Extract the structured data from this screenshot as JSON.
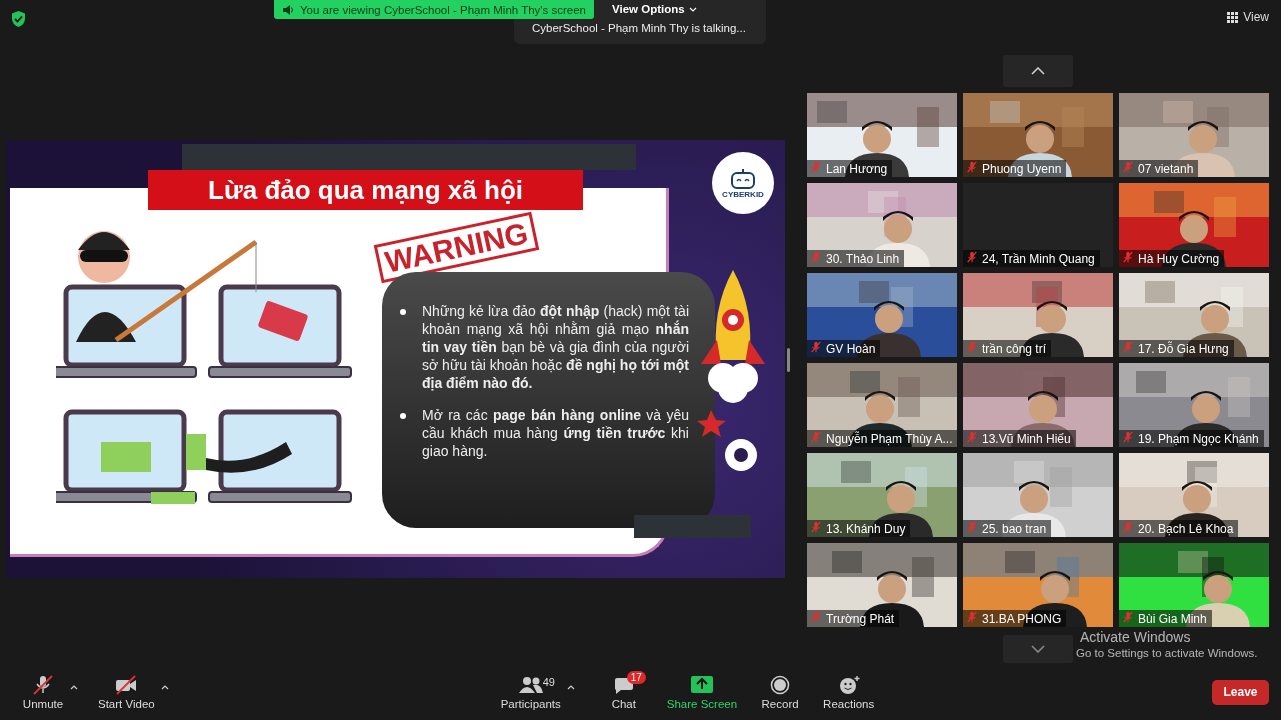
{
  "top_bar": {
    "banner": "You are viewing CyberSchool - Phạm Minh Thy's screen",
    "view_options": "View Options",
    "talking": "CyberSchool - Phạm Minh Thy is talking...",
    "view": "View"
  },
  "slide": {
    "title": "Lừa đảo qua mạng xã hội",
    "stamp": "WARNING",
    "logo": "CYBERKID",
    "bullets": [
      "Những kẻ lừa đảo **đột nhập** (hack) một tài khoản mạng xã hội nhằm giả mạo **nhắn tin vay tiền** bạn bè và gia đình của người sở hữu tài khoản hoặc **đề nghị họ tới một địa điểm nào đó.**",
      "Mở ra các **page bán hàng online** và yêu cầu khách mua hàng **ứng tiền trước** khi giao hàng."
    ]
  },
  "participants": [
    {
      "name": "Lan Hương",
      "muted": true,
      "kind": "picture"
    },
    {
      "name": "Phuong Uyenn",
      "muted": true,
      "kind": "picture"
    },
    {
      "name": "07 vietanh",
      "muted": true,
      "kind": "picture"
    },
    {
      "name": "30. Thảo Linh",
      "muted": true,
      "kind": "picture"
    },
    {
      "name": "24, Trần Minh Quang",
      "muted": true,
      "kind": "empty"
    },
    {
      "name": "Hà Huy Cường",
      "muted": true,
      "kind": "picture"
    },
    {
      "name": "GV Hoàn",
      "muted": true,
      "kind": "picture"
    },
    {
      "name": "trần công trí",
      "muted": true,
      "kind": "picture"
    },
    {
      "name": "17. Đỗ Gia Hưng",
      "muted": true,
      "kind": "picture"
    },
    {
      "name": "Nguyễn Phạm Thùy A...",
      "muted": true,
      "kind": "picture"
    },
    {
      "name": "13.Vũ Minh Hiếu",
      "muted": true,
      "kind": "picture"
    },
    {
      "name": "19. Phạm Ngọc Khánh",
      "muted": true,
      "kind": "picture"
    },
    {
      "name": "13. Khánh Duy",
      "muted": true,
      "kind": "picture"
    },
    {
      "name": "25. bao tran",
      "muted": true,
      "kind": "picture"
    },
    {
      "name": "20. Bạch Lê Khoa",
      "muted": true,
      "kind": "picture"
    },
    {
      "name": "Trường Phát",
      "muted": true,
      "kind": "picture"
    },
    {
      "name": "31.BA PHONG",
      "muted": true,
      "kind": "picture"
    },
    {
      "name": "Bùi Gia Minh",
      "muted": true,
      "kind": "picture"
    }
  ],
  "system_notice": {
    "title": "Activate Windows",
    "message": "Go to Settings to activate Windows."
  },
  "toolbar": {
    "left": [
      {
        "label": "Unmute",
        "kind": "mic",
        "off": true,
        "menu": true
      },
      {
        "label": "Start Video",
        "kind": "video",
        "off": true,
        "menu": true
      }
    ],
    "center": [
      {
        "label": "Participants",
        "kind": "participants",
        "count": "49",
        "menu": true
      },
      {
        "label": "Chat",
        "kind": "chat",
        "badge": "17"
      },
      {
        "label": "Share Screen",
        "kind": "share"
      },
      {
        "label": "Record",
        "kind": "record"
      },
      {
        "label": "Reactions",
        "kind": "reactions"
      }
    ],
    "leave": "Leave"
  }
}
